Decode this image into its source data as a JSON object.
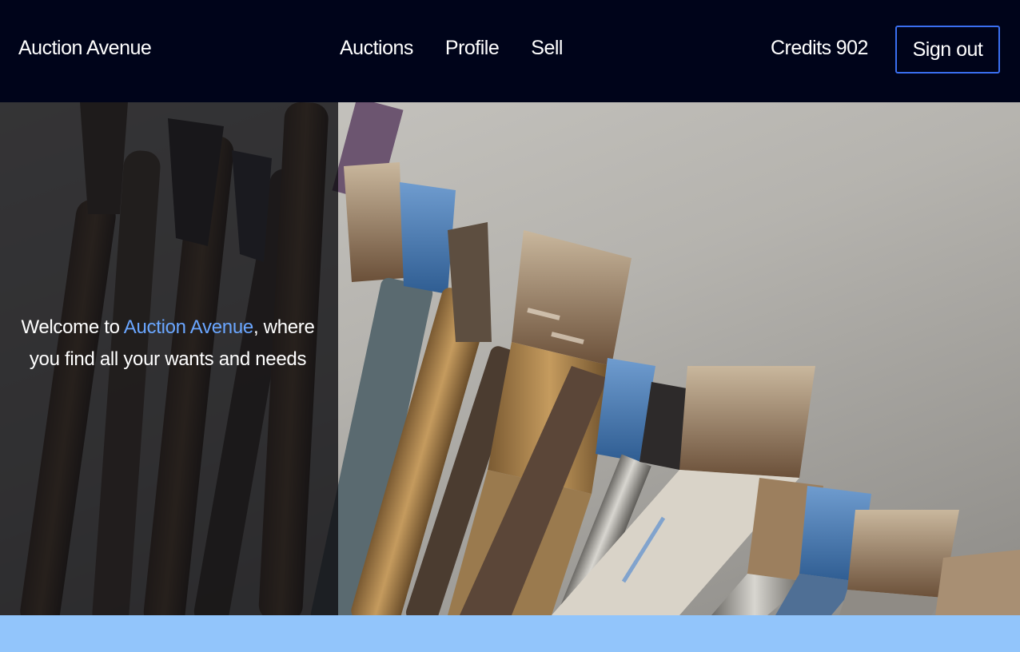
{
  "header": {
    "brand": "Auction Avenue",
    "nav": [
      "Auctions",
      "Profile",
      "Sell"
    ],
    "credits_label": "Credits",
    "credits_value": "902",
    "signout_label": "Sign out"
  },
  "hero": {
    "welcome_prefix": "Welcome to ",
    "welcome_accent": "Auction Avenue",
    "welcome_suffix": ", where you find all your wants and needs",
    "image": "paint-brushes-photo"
  },
  "colors": {
    "header_bg": "#00041a",
    "accent": "#6aa6ff",
    "button_border": "#3a6ff0",
    "band": "#92c5fb"
  }
}
